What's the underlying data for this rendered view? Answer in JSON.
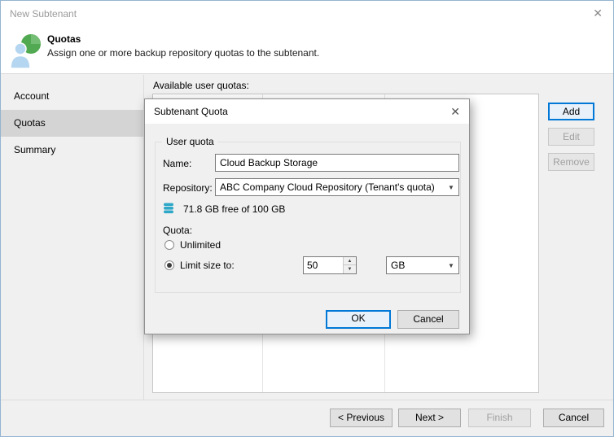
{
  "colors": {
    "accent": "#0078d7",
    "header_icon_green": "#51a951",
    "header_icon_blue": "#b5d6f0",
    "db_icon_teal": "#2fa8c8",
    "sidebar_selected_bg": "#d4d4d4"
  },
  "icons": {
    "close": "✕",
    "dropdown_arrow": "▼",
    "spin_up": "▲",
    "spin_down": "▼"
  },
  "window": {
    "title": "New Subtenant"
  },
  "header": {
    "title": "Quotas",
    "subtitle": "Assign one or more backup repository quotas to the subtenant."
  },
  "sidebar": {
    "items": [
      {
        "label": "Account",
        "selected": false
      },
      {
        "label": "Quotas",
        "selected": true
      },
      {
        "label": "Summary",
        "selected": false
      }
    ]
  },
  "main": {
    "quotas_label": "Available user quotas:",
    "add_button": "Add",
    "edit_button": "Edit",
    "remove_button": "Remove",
    "edit_enabled": false,
    "remove_enabled": false
  },
  "dialog": {
    "title": "Subtenant Quota",
    "group_label": "User quota",
    "name_label": "Name:",
    "name_value": "Cloud Backup Storage",
    "repository_label": "Repository:",
    "repository_value": "ABC Company Cloud Repository (Tenant's quota)",
    "free_space_text": "71.8 GB free of 100 GB",
    "quota_label": "Quota:",
    "unlimited_label": "Unlimited",
    "unlimited_selected": false,
    "limit_label": "Limit size to:",
    "limit_selected": true,
    "limit_value": "50",
    "unit_value": "GB",
    "ok_button": "OK",
    "cancel_button": "Cancel"
  },
  "footer": {
    "previous_button": "< Previous",
    "next_button": "Next >",
    "finish_button": "Finish",
    "finish_enabled": false,
    "cancel_button": "Cancel"
  }
}
